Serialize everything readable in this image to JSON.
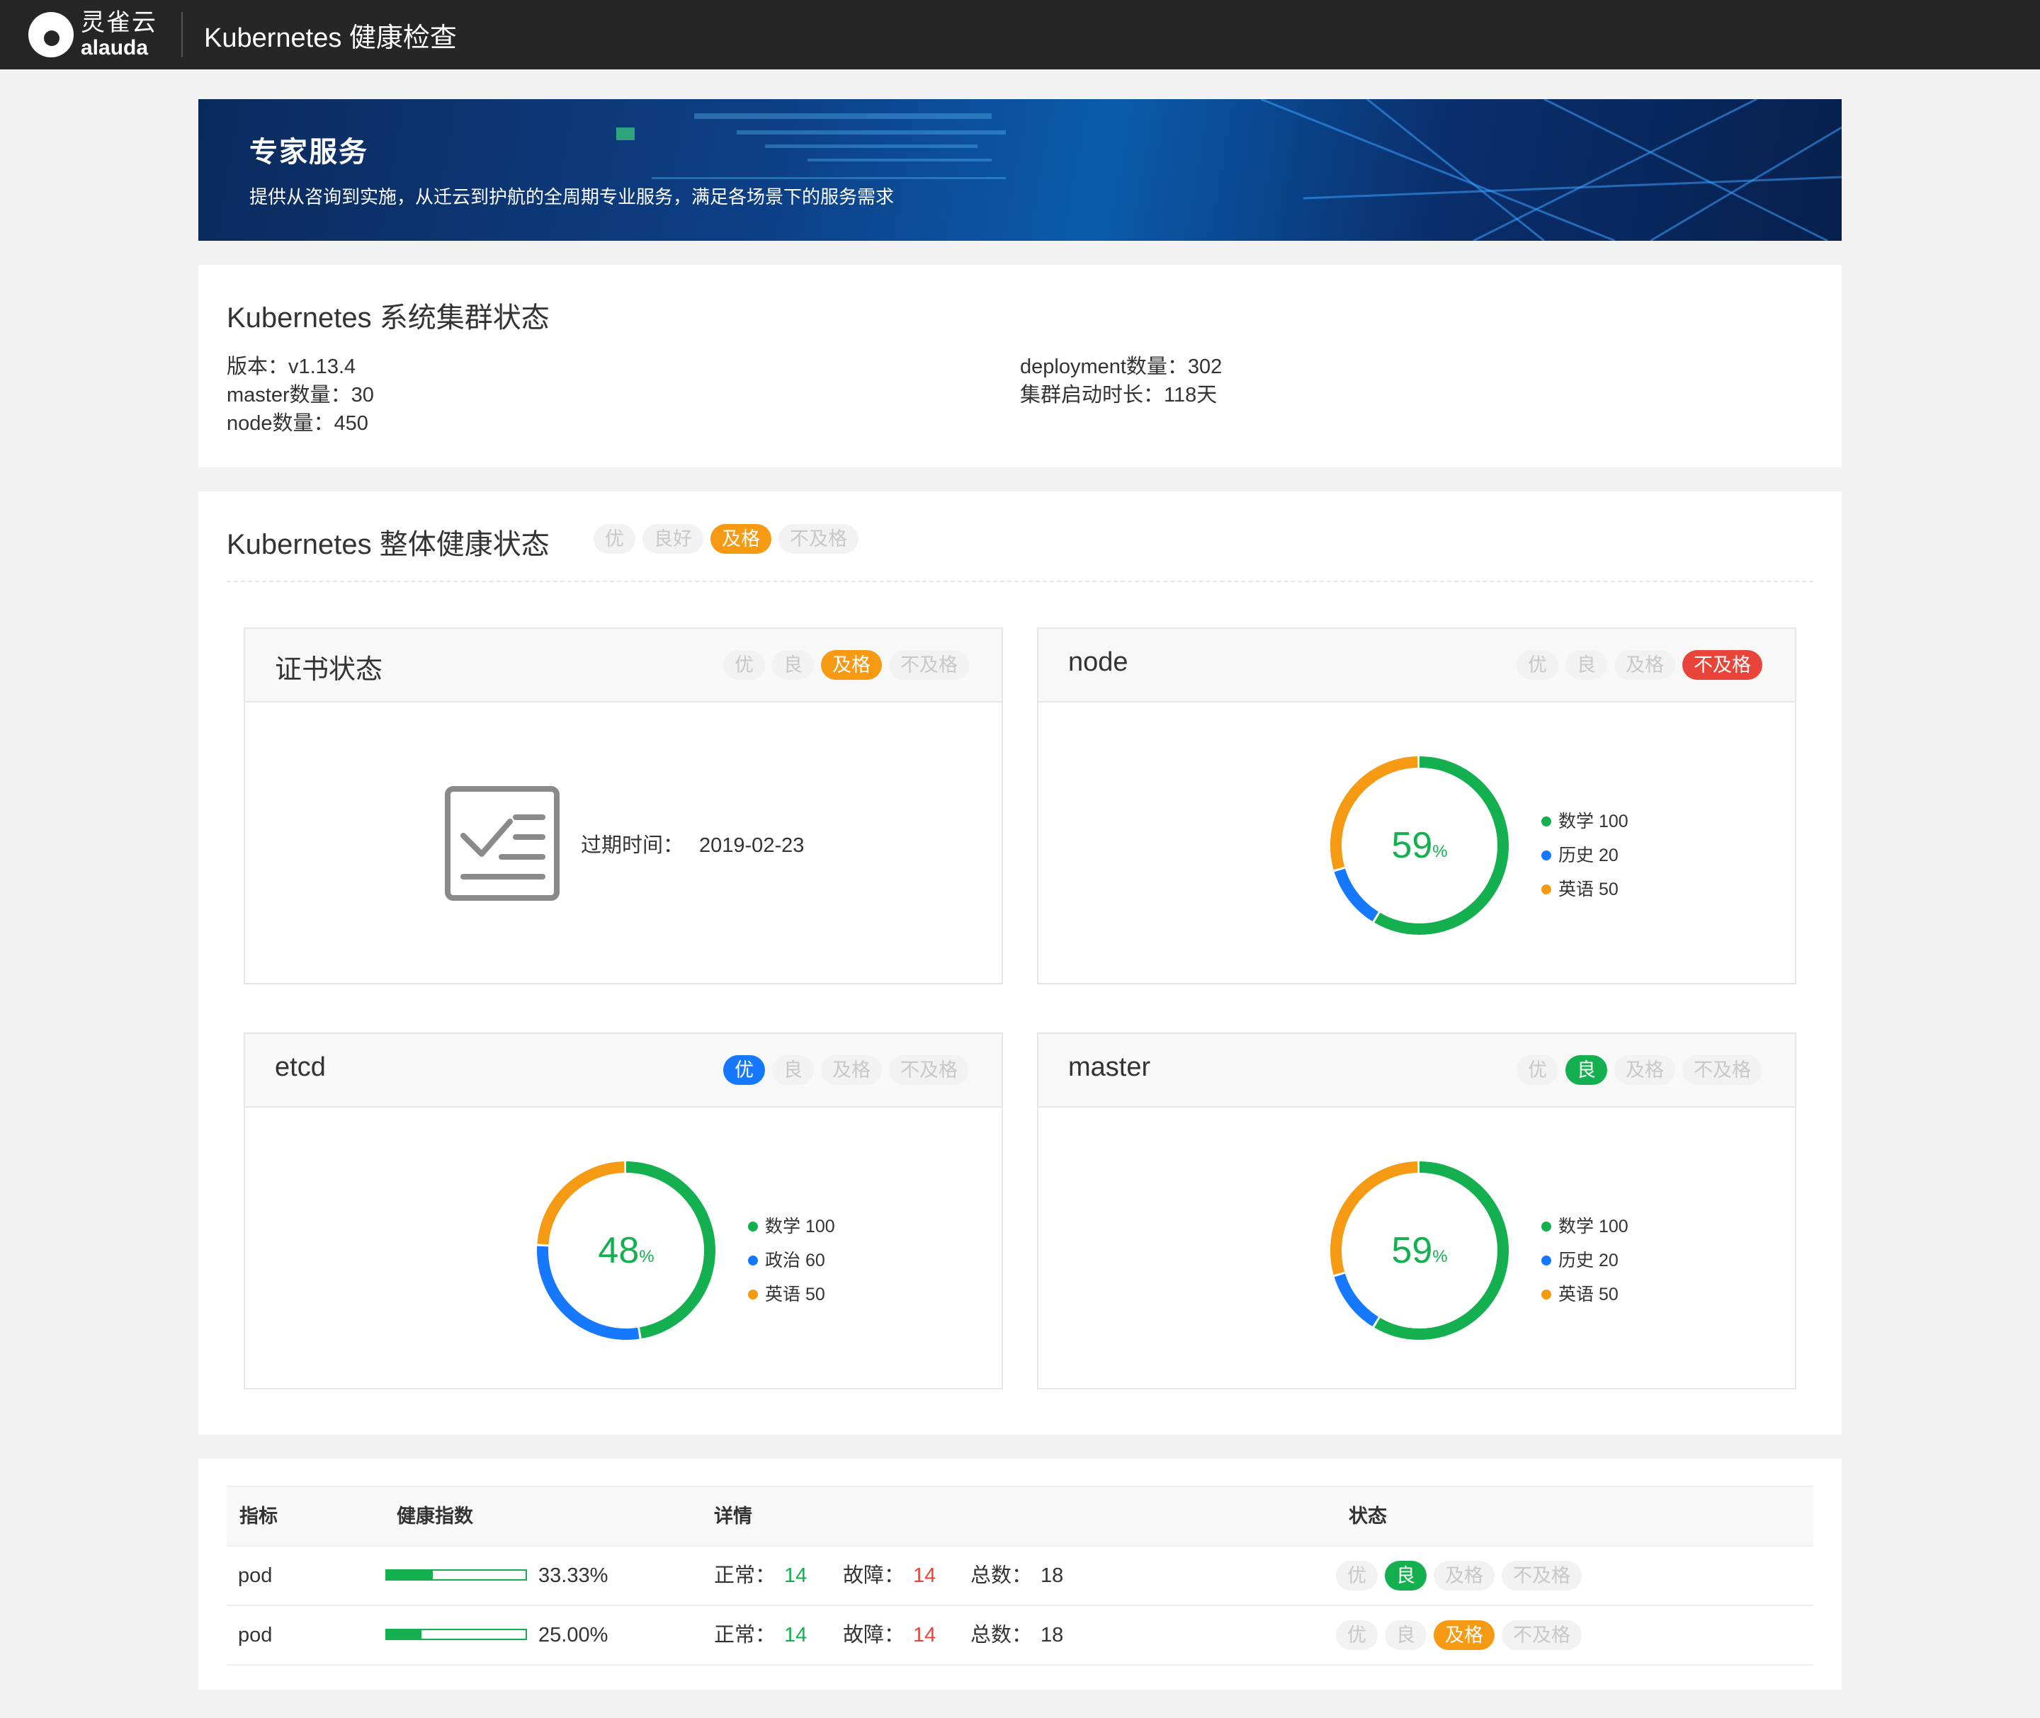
{
  "header": {
    "logo_cn": "灵雀云",
    "logo_en": "alauda",
    "title": "Kubernetes 健康检查"
  },
  "banner": {
    "title": "专家服务",
    "subtitle": "提供从咨询到实施，从迁云到护航的全周期专业服务，满足各场景下的服务需求"
  },
  "cluster": {
    "title": "Kubernetes 系统集群状态",
    "version": "版本：v1.13.4",
    "master_count": "master数量：30",
    "node_count": "node数量：450",
    "deployment_count": "deployment数量：302",
    "uptime": "集群启动时长：118天"
  },
  "health": {
    "title": "Kubernetes 整体健康状态",
    "tags": [
      "优",
      "良好",
      "及格",
      "不及格"
    ],
    "active_tag": "及格"
  },
  "cards": {
    "cert": {
      "title": "证书状态",
      "tags": [
        "优",
        "良",
        "及格",
        "不及格"
      ],
      "active": "及格",
      "expire_label": "过期时间：",
      "expire_value": "2019-02-23"
    },
    "node": {
      "title": "node",
      "tags": [
        "优",
        "良",
        "及格",
        "不及格"
      ],
      "active": "不及格",
      "percent": "59",
      "percent_unit": "%",
      "legend": [
        {
          "label": "数学 100",
          "value": 100,
          "color": "#14b050"
        },
        {
          "label": "历史 20",
          "value": 20,
          "color": "#1677ff"
        },
        {
          "label": "英语 50",
          "value": 50,
          "color": "#f59a12"
        }
      ]
    },
    "etcd": {
      "title": "etcd",
      "tags": [
        "优",
        "良",
        "及格",
        "不及格"
      ],
      "active": "优",
      "percent": "48",
      "percent_unit": "%",
      "legend": [
        {
          "label": "数学 100",
          "value": 100,
          "color": "#14b050"
        },
        {
          "label": "政治 60",
          "value": 60,
          "color": "#1677ff"
        },
        {
          "label": "英语 50",
          "value": 50,
          "color": "#f59a12"
        }
      ]
    },
    "master": {
      "title": "master",
      "tags": [
        "优",
        "良",
        "及格",
        "不及格"
      ],
      "active": "良",
      "percent": "59",
      "percent_unit": "%",
      "legend": [
        {
          "label": "数学 100",
          "value": 100,
          "color": "#14b050"
        },
        {
          "label": "历史 20",
          "value": 20,
          "color": "#1677ff"
        },
        {
          "label": "英语 50",
          "value": 50,
          "color": "#f59a12"
        }
      ]
    }
  },
  "table": {
    "headers": {
      "metric": "指标",
      "index": "健康指数",
      "detail": "详情",
      "status": "状态"
    },
    "status_tags": [
      "优",
      "良",
      "及格",
      "不及格"
    ],
    "rows": [
      {
        "metric": "pod",
        "progress": 0.3333,
        "percent": "33.33%",
        "normal_label": "正常：",
        "normal": "14",
        "fault_label": "故障：",
        "fault": "14",
        "total_label": "总数：",
        "total": "18",
        "active": "良"
      },
      {
        "metric": "pod",
        "progress": 0.25,
        "percent": "25.00%",
        "normal_label": "正常：",
        "normal": "14",
        "fault_label": "故障：",
        "fault": "14",
        "total_label": "总数：",
        "total": "18",
        "active": "及格"
      }
    ]
  },
  "colors": {
    "green": "#14b050",
    "blue": "#1677ff",
    "orange": "#f59a12",
    "red": "#e8443a",
    "topbar": "#262626"
  },
  "icons": {
    "cert": "checklist-icon",
    "logo": "alauda-logo-icon"
  }
}
